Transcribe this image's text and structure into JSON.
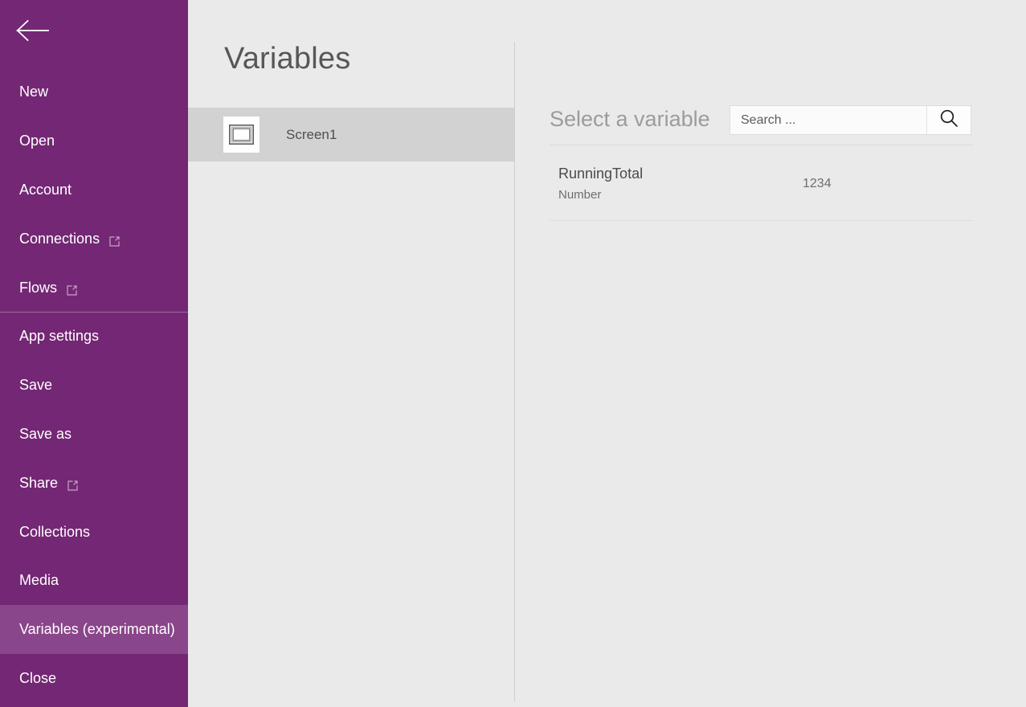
{
  "colors": {
    "sidebar_purple": "#742774",
    "sidebar_selected_purple": "#8a468a",
    "panel_gray": "#eaeaea",
    "selected_row_gray": "#d2d2d2",
    "divider_gray": "#cfcfcf"
  },
  "sidebar": {
    "back_icon": "back-arrow-icon",
    "items": [
      {
        "label": "New",
        "external": false,
        "selected": false,
        "divider_above": false
      },
      {
        "label": "Open",
        "external": false,
        "selected": false,
        "divider_above": false
      },
      {
        "label": "Account",
        "external": false,
        "selected": false,
        "divider_above": false
      },
      {
        "label": "Connections",
        "external": true,
        "selected": false,
        "divider_above": false
      },
      {
        "label": "Flows",
        "external": true,
        "selected": false,
        "divider_above": false
      },
      {
        "label": "App settings",
        "external": false,
        "selected": false,
        "divider_above": true
      },
      {
        "label": "Save",
        "external": false,
        "selected": false,
        "divider_above": false
      },
      {
        "label": "Save as",
        "external": false,
        "selected": false,
        "divider_above": false
      },
      {
        "label": "Share",
        "external": true,
        "selected": false,
        "divider_above": false
      },
      {
        "label": "Collections",
        "external": false,
        "selected": false,
        "divider_above": false
      },
      {
        "label": "Media",
        "external": false,
        "selected": false,
        "divider_above": false
      },
      {
        "label": "Variables (experimental)",
        "external": false,
        "selected": true,
        "divider_above": false
      },
      {
        "label": "Close",
        "external": false,
        "selected": false,
        "divider_above": false
      }
    ],
    "external_icon": "open-in-new-window-icon"
  },
  "middle_panel": {
    "title": "Variables",
    "screens": [
      {
        "name": "Screen1",
        "icon": "screen-thumbnail-icon",
        "selected": true
      }
    ]
  },
  "right_panel": {
    "heading": "Select a variable",
    "search": {
      "value": "",
      "placeholder": "Search ...",
      "icon": "search-icon"
    },
    "variables": [
      {
        "name": "RunningTotal",
        "type": "Number",
        "value": "1234"
      }
    ]
  }
}
